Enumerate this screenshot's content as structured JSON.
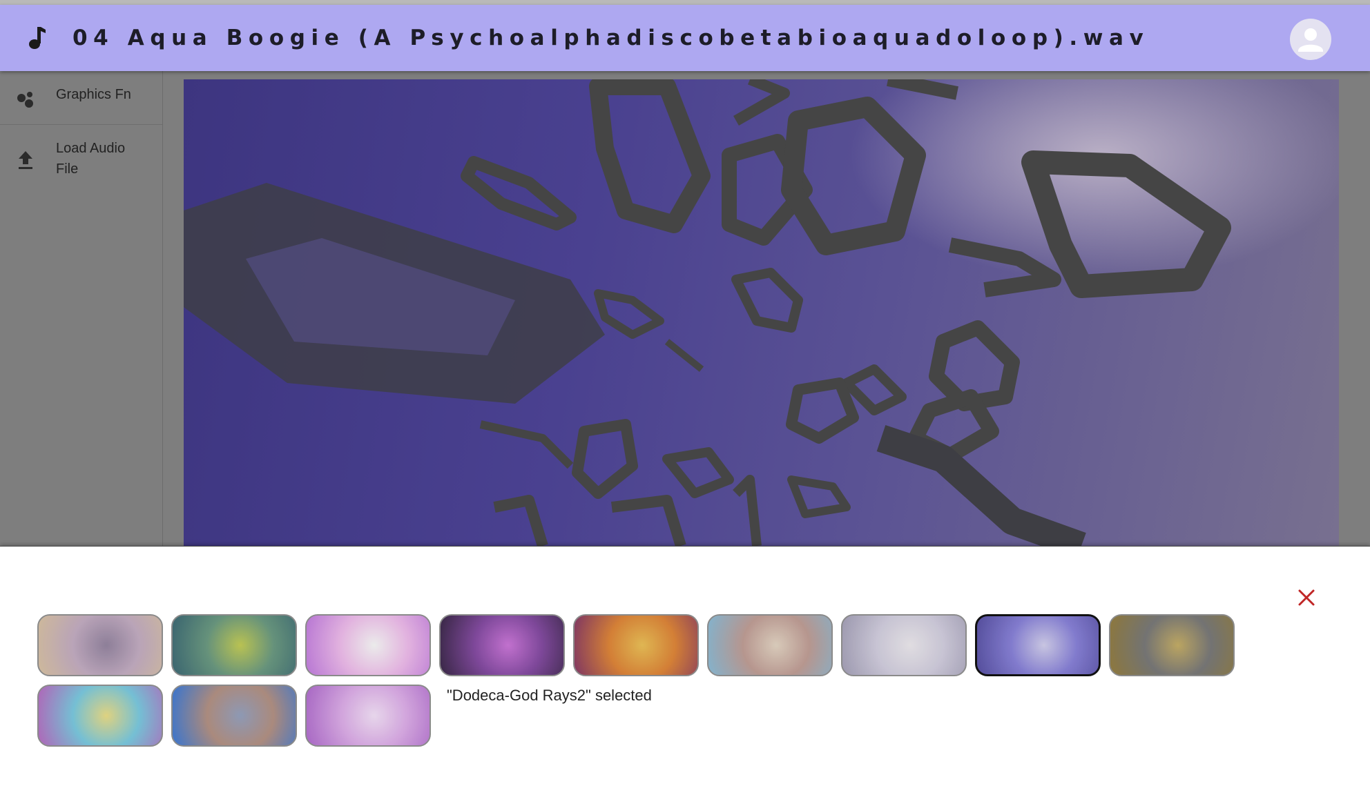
{
  "app_bar": {
    "title": "04 Aqua Boogie (A Psychoalphadiscobetabioaquadoloop).wav",
    "leading_icon": "music-note-icon",
    "trailing_icon": "account-circle-icon"
  },
  "sidebar": {
    "items": [
      {
        "label": "Graphics Fn",
        "icon": "bubble-chart-icon"
      },
      {
        "label": "Load Audio\nFile",
        "icon": "upload-icon"
      }
    ]
  },
  "drawer": {
    "close_icon": "close-icon",
    "status_text": "\"Dodeca-God Rays2\" selected",
    "thumbnails": [
      {
        "selected": false,
        "palette": [
          "#c9b2c8",
          "#9a8aa6",
          "#e0c9a8"
        ]
      },
      {
        "selected": false,
        "palette": [
          "#6f9f86",
          "#c9d35a",
          "#3f6d79"
        ]
      },
      {
        "selected": false,
        "palette": [
          "#f6c3f2",
          "#ffffff",
          "#c780e6"
        ]
      },
      {
        "selected": false,
        "palette": [
          "#8a4fa8",
          "#d27be0",
          "#3c2a4a"
        ]
      },
      {
        "selected": false,
        "palette": [
          "#e58a3b",
          "#f2c65a",
          "#8a3b6b"
        ]
      },
      {
        "selected": false,
        "palette": [
          "#c6a39b",
          "#eadbc9",
          "#8ec2df"
        ]
      },
      {
        "selected": false,
        "palette": [
          "#d9d5e6",
          "#f3f0f4",
          "#a9a5bd"
        ]
      },
      {
        "selected": true,
        "palette": [
          "#8d86df",
          "#d9d6f4",
          "#5b54a8"
        ]
      },
      {
        "selected": false,
        "palette": [
          "#7d7d7d",
          "#cbb36a",
          "#9a8341"
        ]
      },
      {
        "selected": false,
        "palette": [
          "#7fd0e6",
          "#f2e48b",
          "#c06ec8"
        ]
      },
      {
        "selected": false,
        "palette": [
          "#b99688",
          "#9aa6c4",
          "#3e7fe0"
        ]
      },
      {
        "selected": false,
        "palette": [
          "#e3b2ef",
          "#fbe8ff",
          "#b56fd4"
        ]
      }
    ]
  }
}
